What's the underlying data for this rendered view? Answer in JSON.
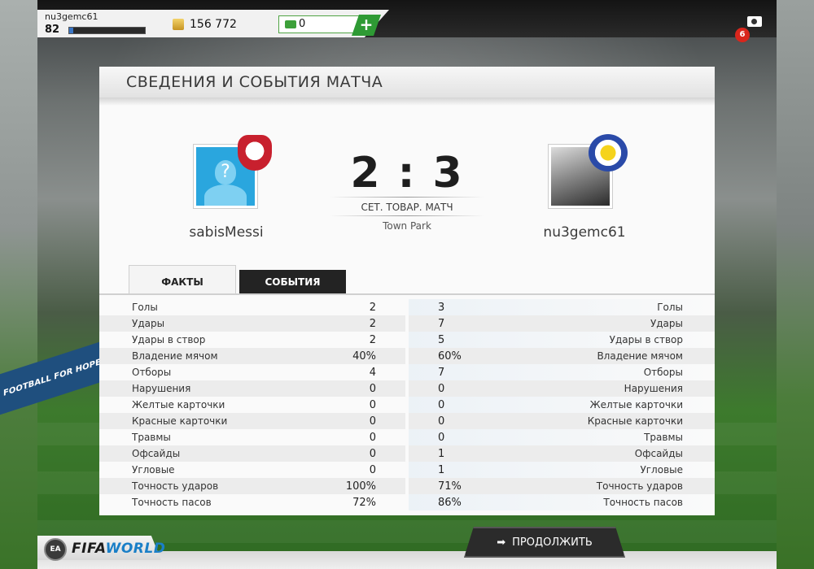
{
  "topbar": {
    "username": "nu3gemc61",
    "level": "82",
    "xp_progress": 0.05,
    "coins": "156 772",
    "points": "0",
    "add_label": "+",
    "notifications": "6"
  },
  "panel": {
    "title": "СВЕДЕНИЯ И СОБЫТИЯ МАТЧА"
  },
  "match": {
    "home_name": "sabisMessi",
    "away_name": "nu3gemc61",
    "score": "2 : 3",
    "match_type": "СЕТ. ТОВАР. МАТЧ",
    "venue": "Town Park",
    "avatar_placeholder": "?"
  },
  "tabs": {
    "facts": "ФАКТЫ",
    "events": "СОБЫТИЯ"
  },
  "stats": [
    {
      "label": "Голы",
      "home": "2",
      "away": "3"
    },
    {
      "label": "Удары",
      "home": "2",
      "away": "7"
    },
    {
      "label": "Удары в створ",
      "home": "2",
      "away": "5"
    },
    {
      "label": "Владение мячом",
      "home": "40%",
      "away": "60%"
    },
    {
      "label": "Отборы",
      "home": "4",
      "away": "7"
    },
    {
      "label": "Нарушения",
      "home": "0",
      "away": "0"
    },
    {
      "label": "Желтые карточки",
      "home": "0",
      "away": "0"
    },
    {
      "label": "Красные карточки",
      "home": "0",
      "away": "0"
    },
    {
      "label": "Травмы",
      "home": "0",
      "away": "0"
    },
    {
      "label": "Офсайды",
      "home": "0",
      "away": "1"
    },
    {
      "label": "Угловые",
      "home": "0",
      "away": "1"
    },
    {
      "label": "Точность ударов",
      "home": "100%",
      "away": "71%"
    },
    {
      "label": "Точность пасов",
      "home": "72%",
      "away": "86%"
    }
  ],
  "footer": {
    "ea_logo": "EA",
    "fifa_logo_a": "FIFA",
    "fifa_logo_b": "WORLD",
    "continue_label": "ПРОДОЛЖИТЬ",
    "continue_arrow": "➡"
  },
  "background": {
    "ad_text": "FOOTBALL FOR HOPE"
  }
}
